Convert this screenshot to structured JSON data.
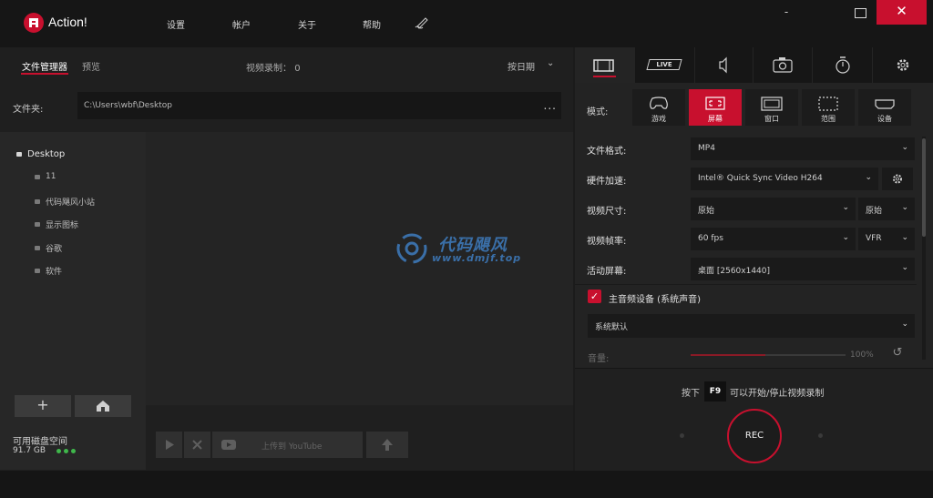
{
  "app": {
    "title": "Action!"
  },
  "menu": {
    "settings": "设置",
    "account": "帐户",
    "about": "关于",
    "help": "帮助"
  },
  "left": {
    "tab_file_manager": "文件管理器",
    "tab_preview": "预览",
    "video_count_label": "视频录制：",
    "video_count": "0",
    "sort_label": "按日期",
    "folder_label": "文件夹:",
    "folder_path": "C:\\Users\\wbf\\Desktop",
    "folder_more": "...",
    "tree": {
      "root": "Desktop",
      "children": [
        "11",
        "代码飓风小站",
        "显示图标",
        "谷歌",
        "软件"
      ]
    },
    "disk_label": "可用磁盘空间",
    "disk_value": "91.7 GB",
    "youtube_label": "上传到 YouTube"
  },
  "watermark": {
    "cn": "代码飓风",
    "en": "www.dmjf.top"
  },
  "right": {
    "tab_live": "LIVE",
    "mode_label": "模式:",
    "modes": [
      "游戏",
      "屏幕",
      "窗口",
      "范围",
      "设备"
    ],
    "active_mode": "屏幕",
    "settings": {
      "file_format_label": "文件格式:",
      "file_format": "MP4",
      "hw_accel_label": "硬件加速:",
      "hw_accel": "Intel® Quick Sync Video H264",
      "video_size_label": "视频尺寸:",
      "video_size": "原始",
      "video_size_2": "原始",
      "frame_rate_label": "视频帧率:",
      "frame_rate": "60 fps",
      "frame_rate_mode": "VFR",
      "active_screen_label": "活动屏幕:",
      "active_screen": "桌面 [2560x1440]"
    },
    "audio": {
      "checkbox_label": "主音频设备 (系统声音)",
      "checked": true,
      "device": "系统默认",
      "volume_label": "音量:",
      "volume": "100%"
    },
    "hint": {
      "press": "按下",
      "key": "F9",
      "text": "可以开始/停止视频录制"
    },
    "rec_label": "REC"
  },
  "colors": {
    "accent": "#c8102e",
    "disk_ok": "#3fb74b",
    "watermark": "#3a6fa8"
  }
}
